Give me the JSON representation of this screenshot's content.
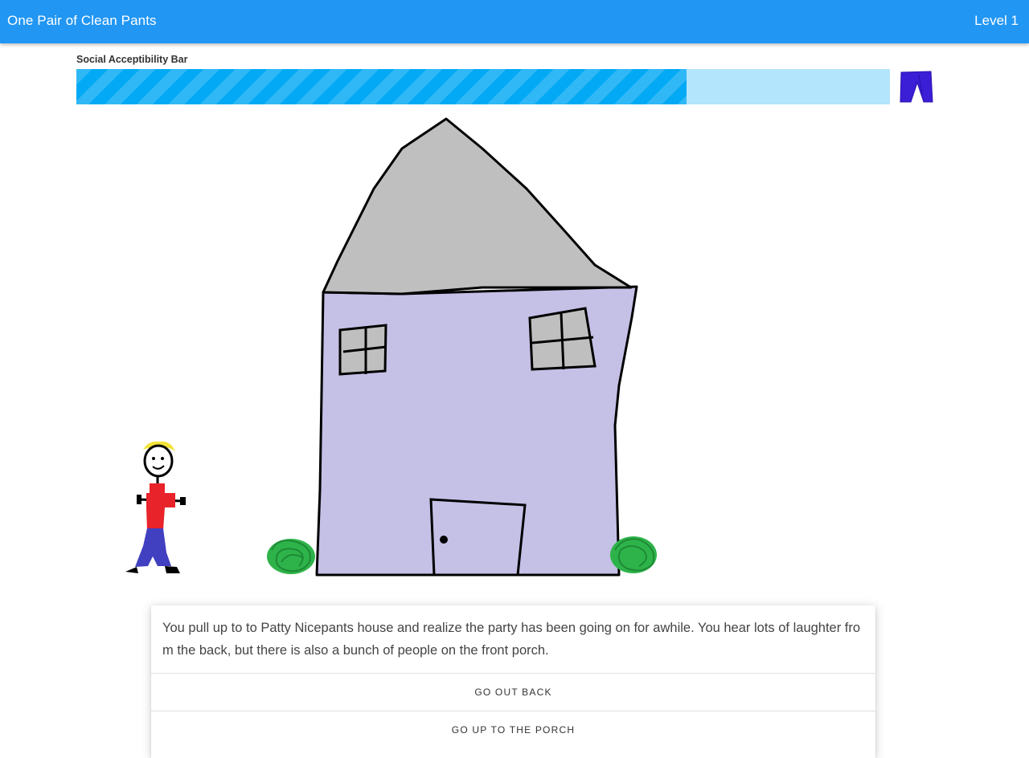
{
  "header": {
    "title": "One Pair of Clean Pants",
    "level": "Level 1"
  },
  "acceptability": {
    "label": "Social Acceptibility Bar",
    "value_fraction": 0.75,
    "fill_color": "#03a9f4",
    "track_color": "#b3e5fc",
    "icon": "pants-icon"
  },
  "scene": {
    "icons": [
      "house",
      "stick-figure-player",
      "bush-left",
      "bush-right"
    ]
  },
  "story": {
    "text": "You pull up to to Patty Nicepants house and realize the party has been going on for awhile. You hear lots of laughter from the back, but there is also a bunch of people on the front porch.",
    "choices": [
      {
        "label": "GO OUT BACK"
      },
      {
        "label": "GO UP TO THE PORCH"
      }
    ]
  },
  "colors": {
    "app_bar": "#2196f3",
    "house_wall": "#c5c0e6",
    "roof": "#bfbfbf",
    "shirt": "#e8232a",
    "pants": "#4040c0",
    "bush": "#2eb34a",
    "hair": "#f2e33a"
  }
}
